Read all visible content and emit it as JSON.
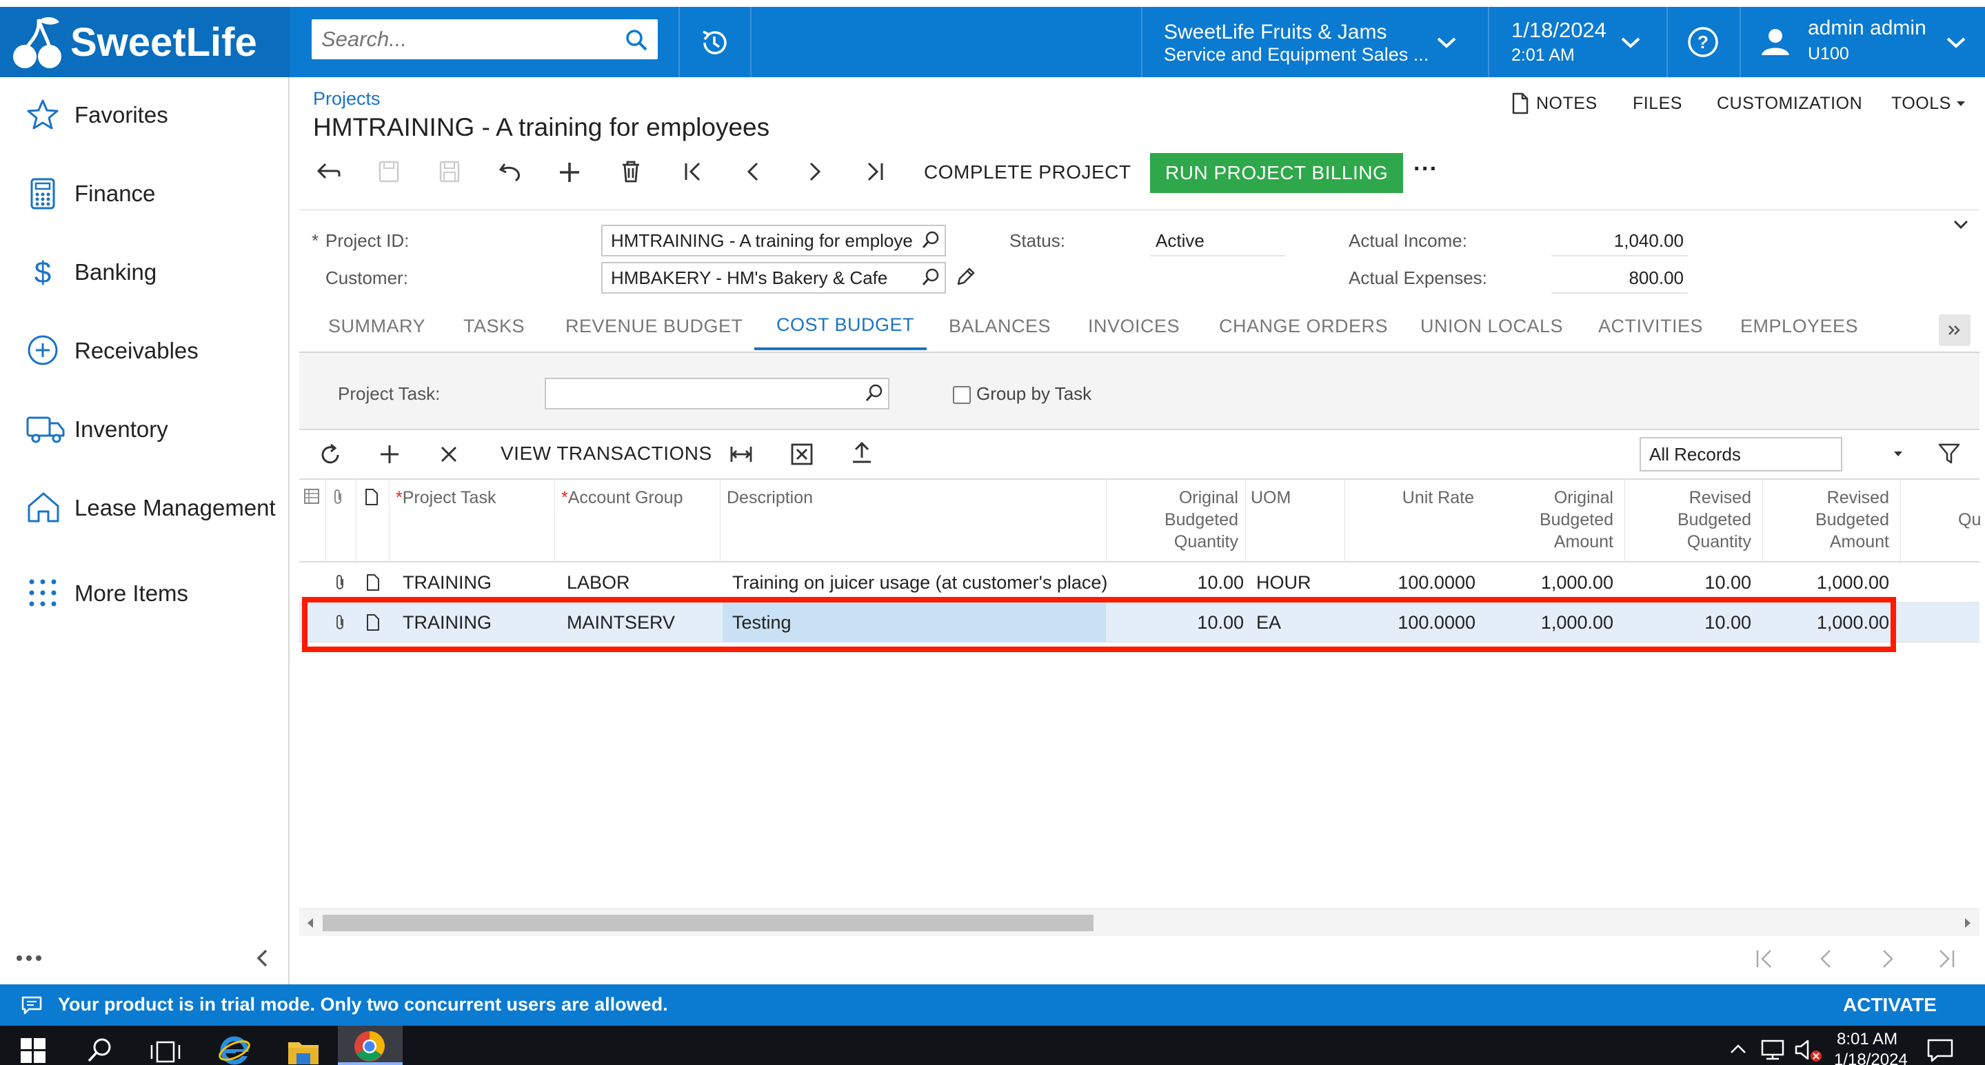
{
  "logo": {
    "text": "SweetLife"
  },
  "search": {
    "placeholder": "Search..."
  },
  "tenant": {
    "line1": "SweetLife Fruits & Jams",
    "line2": "Service and Equipment Sales ..."
  },
  "datetime": {
    "date": "1/18/2024",
    "time": "2:01 AM"
  },
  "user": {
    "name": "admin admin",
    "branch": "U100"
  },
  "sidebar": {
    "items": [
      {
        "label": "Favorites",
        "icon": "star-icon"
      },
      {
        "label": "Finance",
        "icon": "calculator-icon"
      },
      {
        "label": "Banking",
        "icon": "dollar-icon"
      },
      {
        "label": "Receivables",
        "icon": "plus-circle-icon"
      },
      {
        "label": "Inventory",
        "icon": "truck-icon"
      },
      {
        "label": "Lease Management",
        "icon": "house-icon"
      },
      {
        "label": "More Items",
        "icon": "grid-dots-icon"
      }
    ]
  },
  "page": {
    "breadcrumb": "Projects",
    "title": "HMTRAINING - A training for employees",
    "header_links": {
      "notes": "NOTES",
      "files": "FILES",
      "customization": "CUSTOMIZATION",
      "tools": "TOOLS"
    }
  },
  "toolbar": {
    "complete": "COMPLETE PROJECT",
    "run_billing": "RUN PROJECT BILLING",
    "more": "···"
  },
  "form": {
    "project_id_label": "Project ID:",
    "project_id_value": "HMTRAINING - A training for employe",
    "customer_label": "Customer:",
    "customer_value": "HMBAKERY - HM's Bakery & Cafe",
    "status_label": "Status:",
    "status_value": "Active",
    "income_label": "Actual Income:",
    "income_value": "1,040.00",
    "expenses_label": "Actual Expenses:",
    "expenses_value": "800.00"
  },
  "tabs": [
    "SUMMARY",
    "TASKS",
    "REVENUE BUDGET",
    "COST BUDGET",
    "BALANCES",
    "INVOICES",
    "CHANGE ORDERS",
    "UNION LOCALS",
    "ACTIVITIES",
    "EMPLOYEES"
  ],
  "active_tab": "COST BUDGET",
  "filter": {
    "task_label": "Project Task:",
    "group_label": "Group by Task",
    "records": "All Records"
  },
  "grid_toolbar": {
    "view_transactions": "VIEW TRANSACTIONS"
  },
  "grid": {
    "columns": {
      "task": "Project Task",
      "group": "Account Group",
      "desc": "Description",
      "obq": [
        "Original",
        "Budgeted",
        "Quantity"
      ],
      "uom": "UOM",
      "rate": "Unit Rate",
      "oba": [
        "Original",
        "Budgeted",
        "Amount"
      ],
      "rbq": [
        "Revised",
        "Budgeted",
        "Quantity"
      ],
      "rba": [
        "Revised",
        "Budgeted",
        "Amount"
      ],
      "extra": "Qu"
    },
    "rows": [
      {
        "task": "TRAINING",
        "group": "LABOR",
        "desc": "Training on juicer usage (at customer's place)",
        "obq": "10.00",
        "uom": "HOUR",
        "rate": "100.0000",
        "oba": "1,000.00",
        "rbq": "10.00",
        "rba": "1,000.00"
      },
      {
        "task": "TRAINING",
        "group": "MAINTSERV",
        "desc": "Testing",
        "obq": "10.00",
        "uom": "EA",
        "rate": "100.0000",
        "oba": "1,000.00",
        "rbq": "10.00",
        "rba": "1,000.00"
      }
    ]
  },
  "trial": {
    "message": "Your product is in trial mode. Only two concurrent users are allowed.",
    "activate": "ACTIVATE"
  },
  "taskbar": {
    "time": "8:01 AM",
    "date": "1/18/2024"
  },
  "colors": {
    "brand": "#0b7ad1",
    "green": "#2ea84a",
    "highlight": "#ff1a00",
    "selected_row": "#e3eef8"
  }
}
